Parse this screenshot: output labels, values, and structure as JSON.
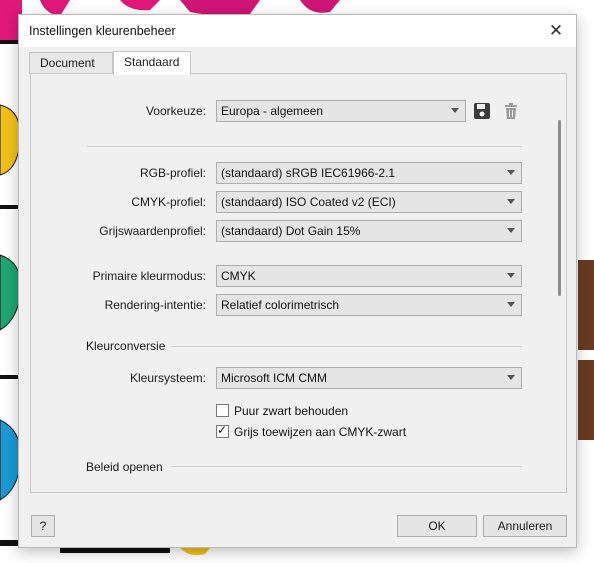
{
  "dialog": {
    "title": "Instellingen kleurenbeheer",
    "tabs": [
      "Document",
      "Standaard"
    ],
    "active_tab": "Standaard"
  },
  "preset": {
    "label": "Voorkeuze:",
    "value": "Europa - algemeen",
    "save_icon": "save-icon",
    "delete_icon": "trash-icon"
  },
  "profiles": [
    {
      "label": "RGB-profiel:",
      "value": "(standaard) sRGB IEC61966-2.1"
    },
    {
      "label": "CMYK-profiel:",
      "value": "(standaard) ISO Coated v2 (ECI)"
    },
    {
      "label": "Grijswaardenprofiel:",
      "value": "(standaard) Dot Gain 15%"
    }
  ],
  "mode": [
    {
      "label": "Primaire kleurmodus:",
      "value": "CMYK"
    },
    {
      "label": "Rendering-intentie:",
      "value": "Relatief colorimetrisch"
    }
  ],
  "conversion": {
    "heading": "Kleurconversie",
    "system_label": "Kleursysteem:",
    "system_value": "Microsoft ICM CMM",
    "options": [
      {
        "label": "Puur zwart behouden",
        "checked": false
      },
      {
        "label": "Grijs toewijzen aan CMYK-zwart",
        "checked": true
      }
    ]
  },
  "open_policy": {
    "heading": "Beleid openen"
  },
  "footer": {
    "help": "?",
    "ok": "OK",
    "cancel": "Annuleren"
  }
}
